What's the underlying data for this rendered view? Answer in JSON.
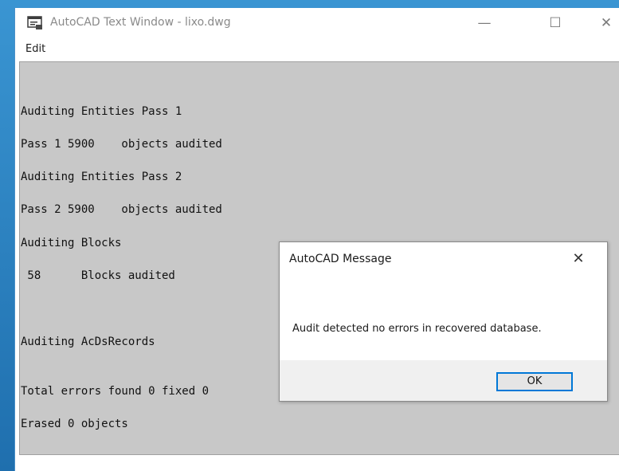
{
  "window": {
    "title": "AutoCAD Text Window - lixo.dwg",
    "controls": {
      "minimize": "—",
      "maximize": "☐",
      "close": "✕"
    }
  },
  "menu": {
    "edit": "Edit"
  },
  "console": {
    "lines": [
      "Auditing Entities Pass 1",
      "Pass 1 5900    objects audited",
      "Auditing Entities Pass 2",
      "Pass 2 5900    objects audited",
      "Auditing Blocks",
      " 58      Blocks audited",
      "Auditing AcDsRecords",
      "Total errors found 0 fixed 0",
      "Erased 0 objects"
    ]
  },
  "dialog": {
    "title": "AutoCAD Message",
    "close": "✕",
    "message": "Audit detected no errors in recovered database.",
    "ok_label": "OK"
  },
  "colors": {
    "accent": "#0078d7",
    "console_bg": "#c8c8c8",
    "desktop": "#2c86c4"
  }
}
